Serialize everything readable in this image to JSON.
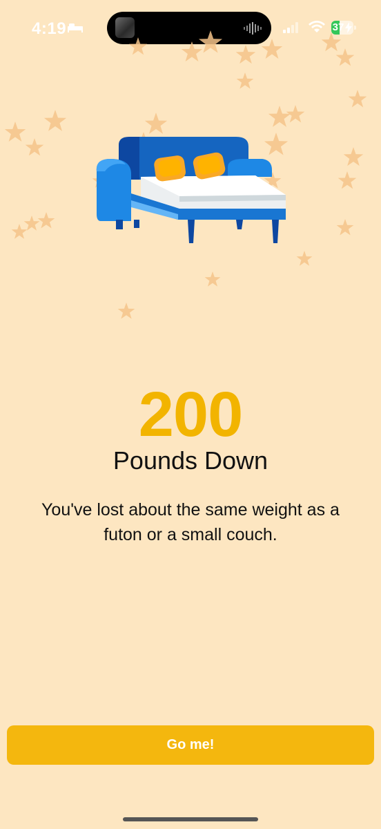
{
  "status_bar": {
    "time": "4:19",
    "battery_level": "37",
    "battery_fraction": 0.37,
    "icons": [
      "bed-icon",
      "signal-icon",
      "wifi-icon",
      "battery-icon",
      "charging-bolt-icon"
    ]
  },
  "milestone": {
    "number": "200",
    "title": "Pounds Down",
    "description": "You've lost about the same weight as a futon or a small couch.",
    "illustration": "couch-icon"
  },
  "action": {
    "button_label": "Go me!"
  },
  "colors": {
    "background": "#fde6c1",
    "accent": "#f2b400",
    "button": "#f4b70e",
    "star": "#f5c48a",
    "couch": "#1e88e5"
  }
}
